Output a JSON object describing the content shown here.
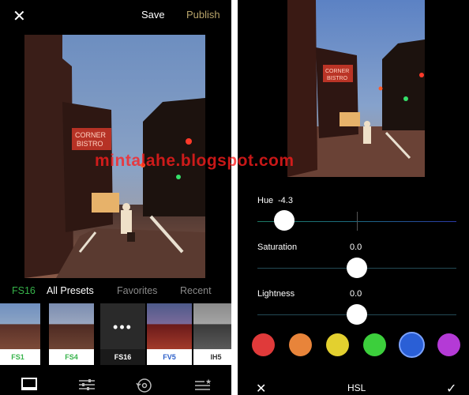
{
  "topbar": {
    "close_icon": "close-icon",
    "save_label": "Save",
    "publish_label": "Publish"
  },
  "watermark": "mintalahe.blogspot.com",
  "preset_tabs": [
    {
      "label": "FS16",
      "active": true
    },
    {
      "label": "All Presets"
    },
    {
      "label": "Favorites"
    },
    {
      "label": "Recent"
    }
  ],
  "presets": [
    {
      "label": "FS1"
    },
    {
      "label": "FS4"
    },
    {
      "label": "FS16",
      "selected": true
    },
    {
      "label": "FV5"
    },
    {
      "label": "IH5"
    }
  ],
  "preset_label_colors": {
    "FS1": "#36b34a",
    "FS4": "#36b34a",
    "FS16": "#ffffff",
    "FV5": "#2c5fc9",
    "IH5": "#333333"
  },
  "toolbar_icons": [
    "frame-icon",
    "sliders-icon",
    "history-icon",
    "preset-list-icon"
  ],
  "hsl": {
    "title": "HSL",
    "sliders": [
      {
        "label": "Hue",
        "value": "-4.3"
      },
      {
        "label": "Saturation",
        "value": "0.0"
      },
      {
        "label": "Lightness",
        "value": "0.0"
      }
    ],
    "colors": [
      "#e03a3a",
      "#e8843a",
      "#e3d02f",
      "#3ccf3c",
      "#2a5fd6",
      "#b43ad6"
    ],
    "selected_color_index": 4
  },
  "accent_colors": {
    "publish": "#b8a46a",
    "active_tab": "#36b34a"
  }
}
